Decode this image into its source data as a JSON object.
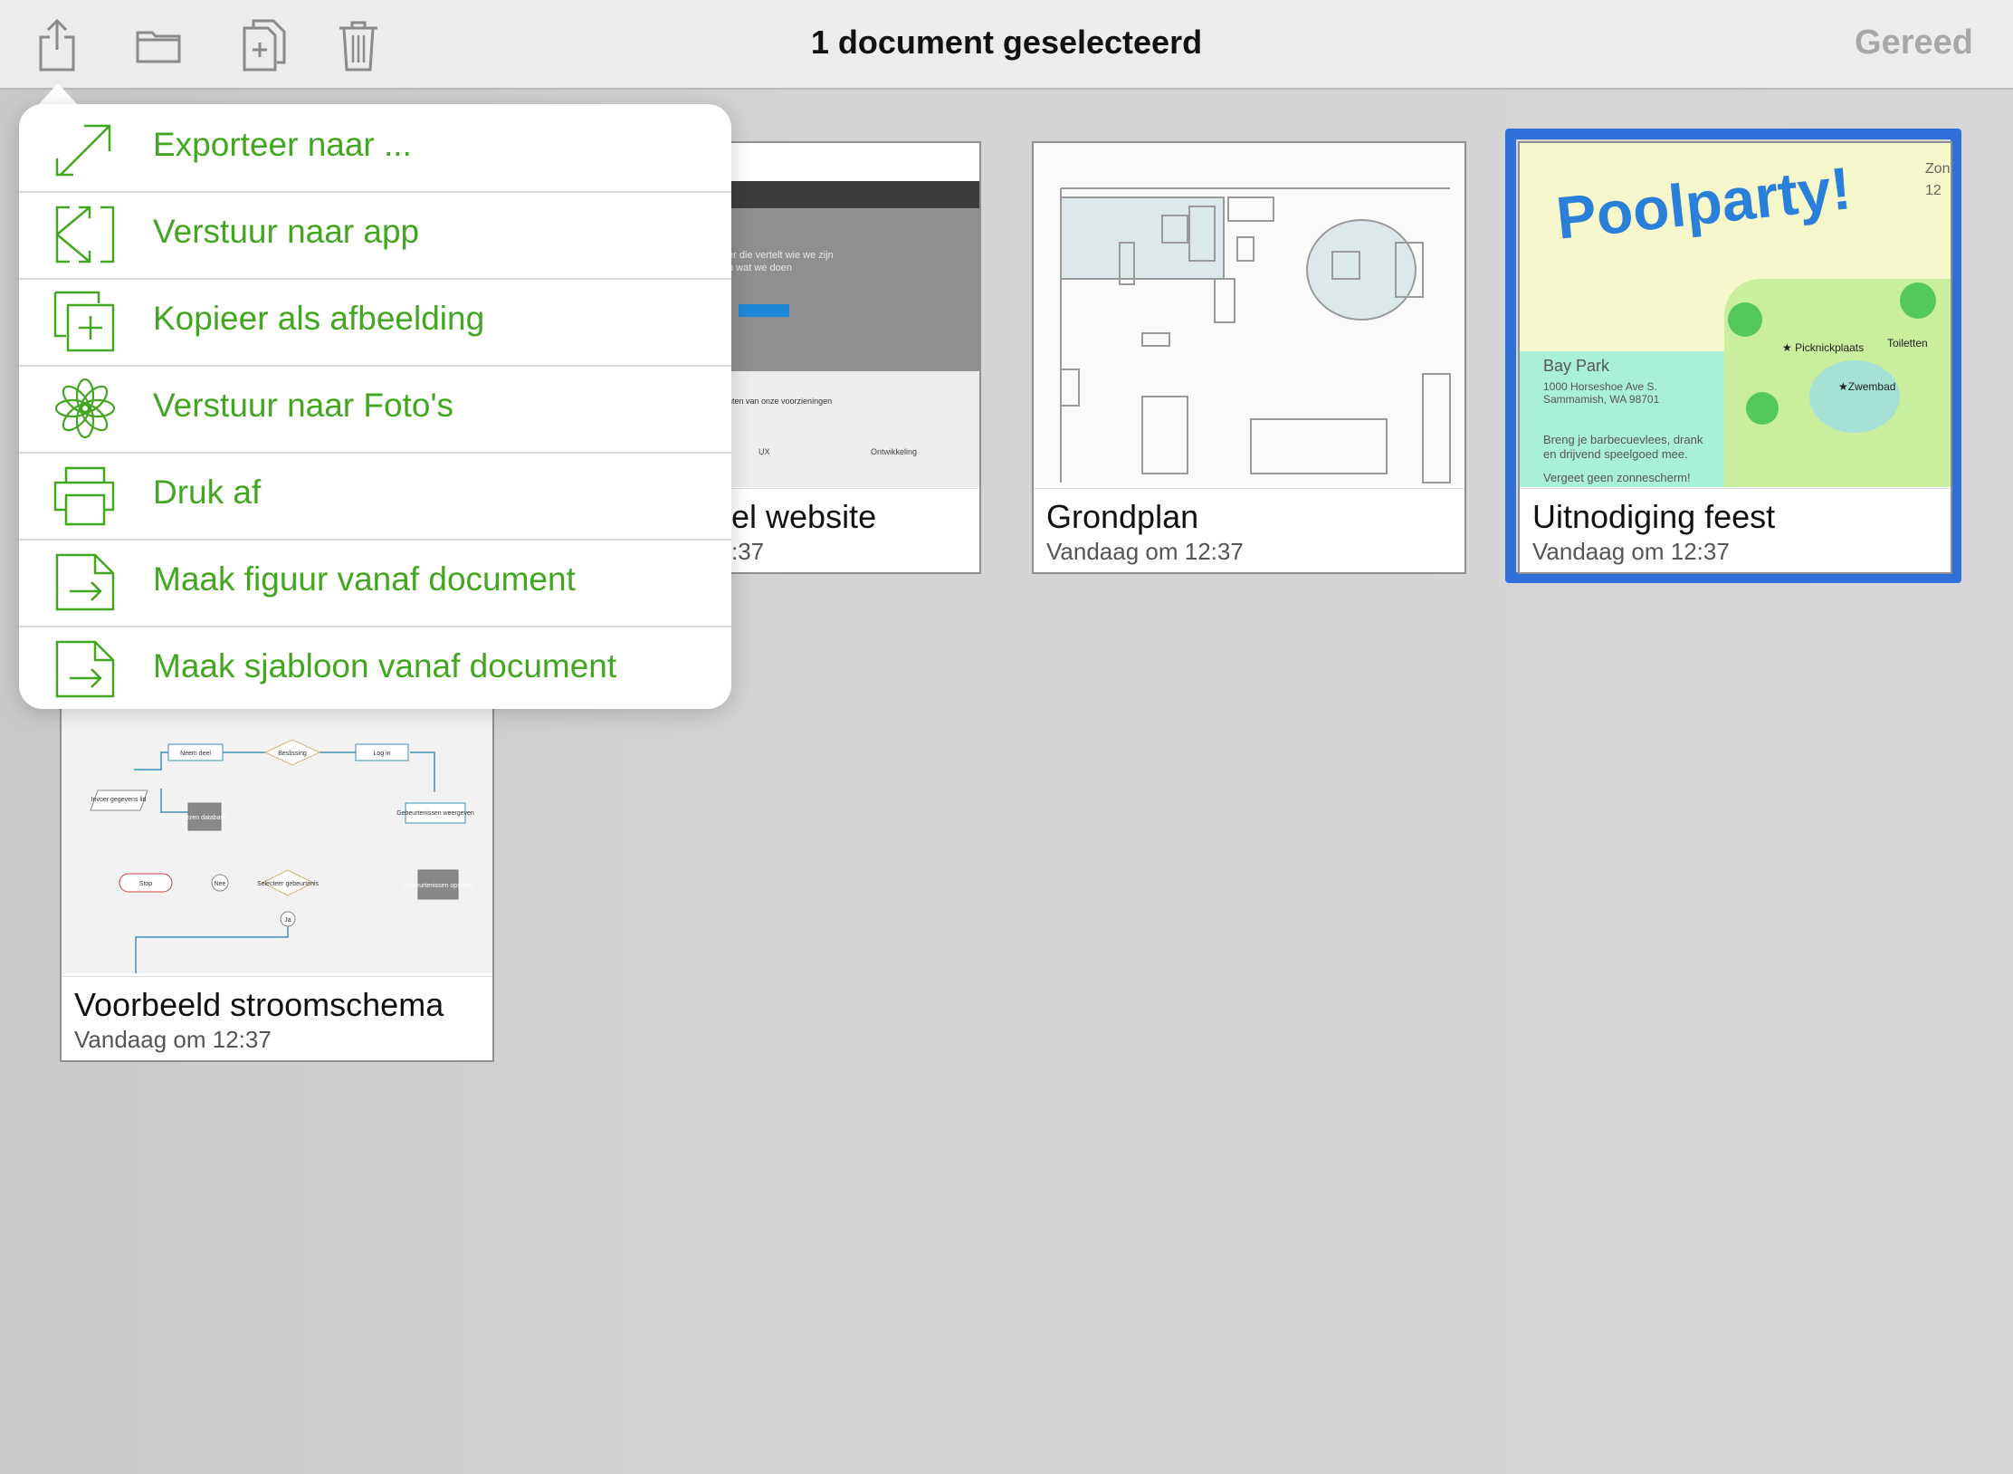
{
  "toolbar": {
    "title": "1 document geselecteerd",
    "done_label": "Gereed",
    "icons": [
      "share-icon",
      "folder-icon",
      "duplicate-icon",
      "trash-icon"
    ]
  },
  "menu": {
    "accent": "#43a620",
    "items": [
      {
        "label": "Exporteer naar ...",
        "icon": "export-arrow-icon"
      },
      {
        "label": "Verstuur naar app",
        "icon": "send-to-app-icon"
      },
      {
        "label": "Kopieer als afbeelding",
        "icon": "copy-image-icon"
      },
      {
        "label": "Verstuur naar Foto's",
        "icon": "photos-flower-icon"
      },
      {
        "label": "Druk af",
        "icon": "printer-icon"
      },
      {
        "label": "Maak figuur vanaf document",
        "icon": "make-shape-icon"
      },
      {
        "label": "Maak sjabloon vanaf document",
        "icon": "make-template-icon"
      }
    ]
  },
  "documents": [
    {
      "name": "el website",
      "date": ":37",
      "thumb": {
        "tagline_1": "er die vertelt wie we zijn",
        "tagline_2": "n wat we doen",
        "section": "nten van onze voorzieningen",
        "col_1": "UX",
        "col_2": "Ontwikkeling"
      }
    },
    {
      "name": "Grondplan",
      "date": "Vandaag om 12:37"
    },
    {
      "name": "Uitnodiging feest",
      "date": "Vandaag om 12:37",
      "selected": true,
      "thumb": {
        "headline": "Poolparty!",
        "corner_1": "Zon",
        "corner_2": "12",
        "place": "Bay Park",
        "address_1": "1000 Horseshoe Ave S.",
        "address_2": "Sammamish, WA 98701",
        "bring_1": "Breng je barbecuevlees, drank",
        "bring_2": "en drijvend speelgoed mee.",
        "reminder": "Vergeet geen zonnescherm!",
        "marker_1": "Picknickplaats",
        "marker_2": "Toiletten",
        "marker_3": "Zwembad"
      }
    },
    {
      "name": "Voorbeeld stroomschema",
      "date": "Vandaag om 12:37",
      "thumb": {
        "nodes": [
          "Neem deel",
          "Beslissing",
          "Log in",
          "Invoer gegevens lid",
          "Lezen database",
          "Gebeurtenissen weergeven",
          "Stop",
          "Nee",
          "Selecteer gebeurtenis",
          "Ja",
          "Gebeurtenissen opslaan"
        ]
      }
    }
  ],
  "selection_color": "#2e6fd8"
}
